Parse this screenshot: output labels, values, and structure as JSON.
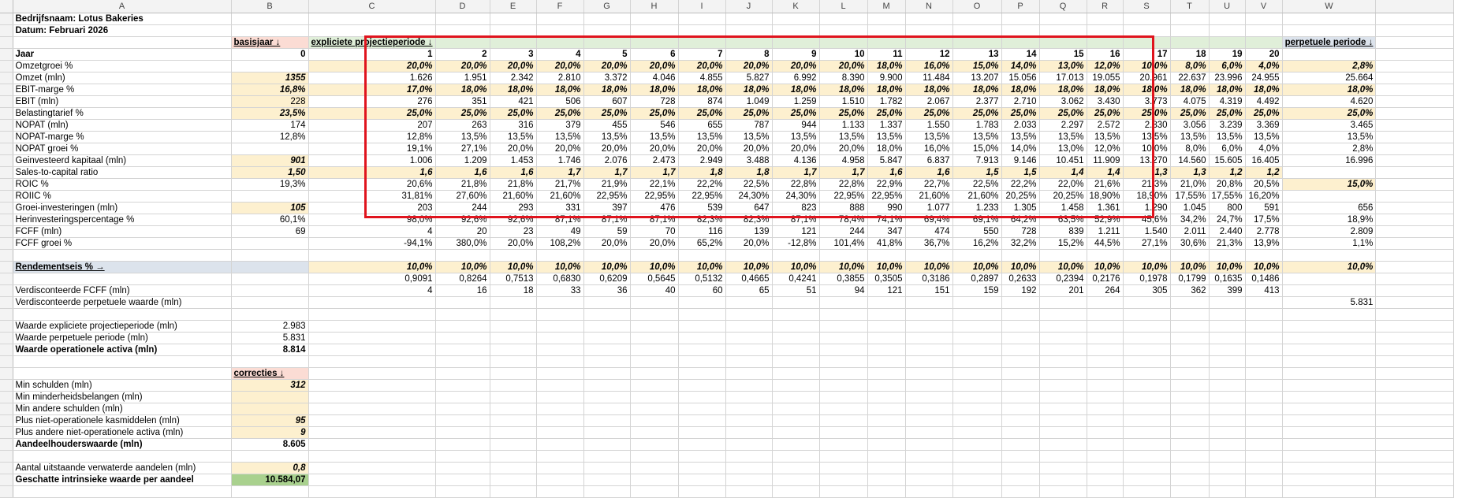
{
  "company_title": "Bedrijfsnaam: Lotus Bakeries",
  "date_title": "Datum: Februari 2026",
  "colors": {
    "highlight_box": "#e0141e",
    "yellow_input": "#fdf0cf",
    "pink_header": "#fbdcd4",
    "green_header": "#e0efd9",
    "blue_header": "#dce3ec",
    "result_green": "#a9d18e"
  },
  "columns": [
    "A",
    "B",
    "C",
    "D",
    "E",
    "F",
    "G",
    "H",
    "I",
    "J",
    "K",
    "L",
    "M",
    "N",
    "O",
    "P",
    "Q",
    "R",
    "S",
    "T",
    "U",
    "V",
    "W"
  ],
  "headers": {
    "basisjaar": "basisjaar ↓",
    "expliciete": "expliciete projectieperiode ↓",
    "perpetuele": "perpetuele periode ↓",
    "rendementseis": "Rendementseis % →",
    "correcties": "correcties ↓"
  },
  "years": [
    "0",
    "1",
    "2",
    "3",
    "4",
    "5",
    "6",
    "7",
    "8",
    "9",
    "10",
    "11",
    "12",
    "13",
    "14",
    "15",
    "16",
    "17",
    "18",
    "19",
    "20"
  ],
  "rows": {
    "r5": {
      "label": "Omzetgroei %",
      "base": "",
      "vals": [
        "20,0%",
        "20,0%",
        "20,0%",
        "20,0%",
        "20,0%",
        "20,0%",
        "20,0%",
        "20,0%",
        "20,0%",
        "20,0%",
        "18,0%",
        "16,0%",
        "15,0%",
        "14,0%",
        "13,0%",
        "12,0%",
        "10,0%",
        "8,0%",
        "6,0%",
        "4,0%"
      ],
      "w": "2,8%"
    },
    "r6": {
      "label": "Omzet (mln)",
      "base": "1355",
      "vals": [
        "1.626",
        "1.951",
        "2.342",
        "2.810",
        "3.372",
        "4.046",
        "4.855",
        "5.827",
        "6.992",
        "8.390",
        "9.900",
        "11.484",
        "13.207",
        "15.056",
        "17.013",
        "19.055",
        "20.961",
        "22.637",
        "23.996",
        "24.955"
      ],
      "w": "25.664"
    },
    "r7": {
      "label": "EBIT-marge %",
      "base": "16,8%",
      "vals": [
        "17,0%",
        "18,0%",
        "18,0%",
        "18,0%",
        "18,0%",
        "18,0%",
        "18,0%",
        "18,0%",
        "18,0%",
        "18,0%",
        "18,0%",
        "18,0%",
        "18,0%",
        "18,0%",
        "18,0%",
        "18,0%",
        "18,0%",
        "18,0%",
        "18,0%",
        "18,0%"
      ],
      "w": "18,0%"
    },
    "r8": {
      "label": "EBIT (mln)",
      "base": "228",
      "vals": [
        "276",
        "351",
        "421",
        "506",
        "607",
        "728",
        "874",
        "1.049",
        "1.259",
        "1.510",
        "1.782",
        "2.067",
        "2.377",
        "2.710",
        "3.062",
        "3.430",
        "3.773",
        "4.075",
        "4.319",
        "4.492"
      ],
      "w": "4.620"
    },
    "r9": {
      "label": "Belastingtarief %",
      "base": "23,5%",
      "vals": [
        "25,0%",
        "25,0%",
        "25,0%",
        "25,0%",
        "25,0%",
        "25,0%",
        "25,0%",
        "25,0%",
        "25,0%",
        "25,0%",
        "25,0%",
        "25,0%",
        "25,0%",
        "25,0%",
        "25,0%",
        "25,0%",
        "25,0%",
        "25,0%",
        "25,0%",
        "25,0%"
      ],
      "w": "25,0%"
    },
    "r10": {
      "label": "NOPAT (mln)",
      "base": "174",
      "vals": [
        "207",
        "263",
        "316",
        "379",
        "455",
        "546",
        "655",
        "787",
        "944",
        "1.133",
        "1.337",
        "1.550",
        "1.783",
        "2.033",
        "2.297",
        "2.572",
        "2.830",
        "3.056",
        "3.239",
        "3.369"
      ],
      "w": "3.465"
    },
    "r11": {
      "label": "NOPAT-marge %",
      "base": "12,8%",
      "vals": [
        "12,8%",
        "13,5%",
        "13,5%",
        "13,5%",
        "13,5%",
        "13,5%",
        "13,5%",
        "13,5%",
        "13,5%",
        "13,5%",
        "13,5%",
        "13,5%",
        "13,5%",
        "13,5%",
        "13,5%",
        "13,5%",
        "13,5%",
        "13,5%",
        "13,5%",
        "13,5%"
      ],
      "w": "13,5%"
    },
    "r12": {
      "label": "NOPAT groei %",
      "base": "",
      "vals": [
        "19,1%",
        "27,1%",
        "20,0%",
        "20,0%",
        "20,0%",
        "20,0%",
        "20,0%",
        "20,0%",
        "20,0%",
        "20,0%",
        "18,0%",
        "16,0%",
        "15,0%",
        "14,0%",
        "13,0%",
        "12,0%",
        "10,0%",
        "8,0%",
        "6,0%",
        "4,0%"
      ],
      "w": "2,8%"
    },
    "r13": {
      "label": "Geinvesteerd kapitaal (mln)",
      "base": "901",
      "vals": [
        "1.006",
        "1.209",
        "1.453",
        "1.746",
        "2.076",
        "2.473",
        "2.949",
        "3.488",
        "4.136",
        "4.958",
        "5.847",
        "6.837",
        "7.913",
        "9.146",
        "10.451",
        "11.909",
        "13.270",
        "14.560",
        "15.605",
        "16.405"
      ],
      "w": "16.996"
    },
    "r14": {
      "label": "Sales-to-capital ratio",
      "base": "1,50",
      "vals": [
        "1,6",
        "1,6",
        "1,6",
        "1,7",
        "1,7",
        "1,7",
        "1,8",
        "1,8",
        "1,7",
        "1,7",
        "1,6",
        "1,6",
        "1,5",
        "1,5",
        "1,4",
        "1,4",
        "1,3",
        "1,3",
        "1,2",
        "1,2"
      ],
      "w": ""
    },
    "r15": {
      "label": "ROIC %",
      "base": "19,3%",
      "vals": [
        "20,6%",
        "21,8%",
        "21,8%",
        "21,7%",
        "21,9%",
        "22,1%",
        "22,2%",
        "22,5%",
        "22,8%",
        "22,8%",
        "22,9%",
        "22,7%",
        "22,5%",
        "22,2%",
        "22,0%",
        "21,6%",
        "21,3%",
        "21,0%",
        "20,8%",
        "20,5%"
      ],
      "w": "15,0%"
    },
    "r16": {
      "label": "ROIIC %",
      "base": "",
      "vals": [
        "31,81%",
        "27,60%",
        "21,60%",
        "21,60%",
        "22,95%",
        "22,95%",
        "22,95%",
        "24,30%",
        "24,30%",
        "22,95%",
        "22,95%",
        "21,60%",
        "21,60%",
        "20,25%",
        "20,25%",
        "18,90%",
        "18,90%",
        "17,55%",
        "17,55%",
        "16,20%"
      ],
      "w": ""
    },
    "r17": {
      "label": "Groei-investeringen (mln)",
      "base": "105",
      "vals": [
        "203",
        "244",
        "293",
        "331",
        "397",
        "476",
        "539",
        "647",
        "823",
        "888",
        "990",
        "1.077",
        "1.233",
        "1.305",
        "1.458",
        "1.361",
        "1.290",
        "1.045",
        "800",
        "591"
      ],
      "w": "656"
    },
    "r18": {
      "label": "Herinvesteringspercentage %",
      "base": "60,1%",
      "vals": [
        "98,0%",
        "92,6%",
        "92,6%",
        "87,1%",
        "87,1%",
        "87,1%",
        "82,3%",
        "82,3%",
        "87,1%",
        "78,4%",
        "74,1%",
        "69,4%",
        "69,1%",
        "64,2%",
        "63,5%",
        "52,9%",
        "45,6%",
        "34,2%",
        "24,7%",
        "17,5%"
      ],
      "w": "18,9%"
    },
    "r19": {
      "label": "FCFF (mln)",
      "base": "69",
      "vals": [
        "4",
        "20",
        "23",
        "49",
        "59",
        "70",
        "116",
        "139",
        "121",
        "244",
        "347",
        "474",
        "550",
        "728",
        "839",
        "1.211",
        "1.540",
        "2.011",
        "2.440",
        "2.778"
      ],
      "w": "2.809"
    },
    "r20": {
      "label": "FCFF groei %",
      "base": "",
      "vals": [
        "-94,1%",
        "380,0%",
        "20,0%",
        "108,2%",
        "20,0%",
        "20,0%",
        "65,2%",
        "20,0%",
        "-12,8%",
        "101,4%",
        "41,8%",
        "36,7%",
        "16,2%",
        "32,2%",
        "15,2%",
        "44,5%",
        "27,1%",
        "30,6%",
        "21,3%",
        "13,9%"
      ],
      "w": "1,1%"
    },
    "r22": {
      "vals": [
        "10,0%",
        "10,0%",
        "10,0%",
        "10,0%",
        "10,0%",
        "10,0%",
        "10,0%",
        "10,0%",
        "10,0%",
        "10,0%",
        "10,0%",
        "10,0%",
        "10,0%",
        "10,0%",
        "10,0%",
        "10,0%",
        "10,0%",
        "10,0%",
        "10,0%",
        "10,0%"
      ],
      "w": "10,0%"
    },
    "r23": {
      "vals": [
        "0,9091",
        "0,8264",
        "0,7513",
        "0,6830",
        "0,6209",
        "0,5645",
        "0,5132",
        "0,4665",
        "0,4241",
        "0,3855",
        "0,3505",
        "0,3186",
        "0,2897",
        "0,2633",
        "0,2394",
        "0,2176",
        "0,1978",
        "0,1799",
        "0,1635",
        "0,1486"
      ],
      "w": ""
    },
    "r24": {
      "label": "Verdisconteerde FCFF (mln)",
      "vals": [
        "4",
        "16",
        "18",
        "33",
        "36",
        "40",
        "60",
        "65",
        "51",
        "94",
        "121",
        "151",
        "159",
        "192",
        "201",
        "264",
        "305",
        "362",
        "399",
        "413"
      ],
      "w": ""
    },
    "r25": {
      "label": "Verdisconteerde perpetuele waarde (mln)",
      "w": "5.831"
    },
    "r27": {
      "label": "Waarde expliciete projectieperiode (mln)",
      "base": "2.983"
    },
    "r28": {
      "label": "Waarde perpetuele periode (mln)",
      "base": "5.831"
    },
    "r29": {
      "label": "Waarde operationele activa (mln)",
      "base": "8.814"
    },
    "r32": {
      "label": "Min schulden (mln)",
      "base": "312"
    },
    "r33": {
      "label": "Min minderheidsbelangen (mln)",
      "base": ""
    },
    "r34": {
      "label": "Min andere schulden (mln)",
      "base": ""
    },
    "r35": {
      "label": "Plus niet-operationele kasmiddelen (mln)",
      "base": "95"
    },
    "r36": {
      "label": "Plus andere niet-operationele activa (mln)",
      "base": "9"
    },
    "r37": {
      "label": "Aandeelhouderswaarde (mln)",
      "base": "8.605"
    },
    "r39": {
      "label": "Aantal uitstaande verwaterde aandelen (mln)",
      "base": "0,8"
    },
    "r40": {
      "label": "Geschatte intrinsieke waarde per aandeel",
      "base": "10.584,07"
    }
  }
}
